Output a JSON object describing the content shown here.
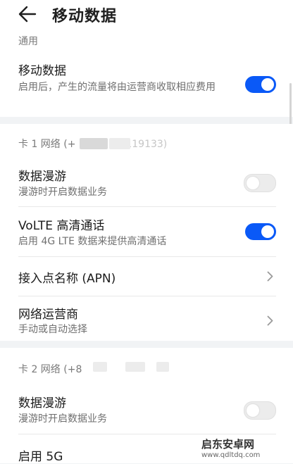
{
  "header": {
    "title": "移动数据"
  },
  "general": {
    "sub_header": "通用",
    "mobile_data": {
      "title": "移动数据",
      "desc": "启用后，产生的流量将由运营商收取相应费用",
      "enabled": true
    }
  },
  "sim1": {
    "sub_header": "卡 1 网络 (+",
    "sub_header_tail": "0119133)",
    "roaming": {
      "title": "数据漫游",
      "desc": "漫游时开启数据业务",
      "enabled": false
    },
    "volte": {
      "title": "VoLTE 高清通话",
      "desc": "启用 4G LTE 数据来提供高清通话",
      "enabled": true
    },
    "apn": {
      "title": "接入点名称 (APN)"
    },
    "operator": {
      "title": "网络运营商",
      "desc": "手动或自动选择"
    }
  },
  "sim2": {
    "sub_header": "卡 2 网络 (+8",
    "roaming": {
      "title": "数据漫游",
      "desc": "漫游时开启数据业务",
      "enabled": false
    },
    "five_g": {
      "title": "启用 5G"
    }
  },
  "watermark": {
    "name": "启东安卓网",
    "url": "www.qdltdq.com"
  },
  "colors": {
    "accent": "#0a59f7",
    "background": "#f1f3f5"
  }
}
